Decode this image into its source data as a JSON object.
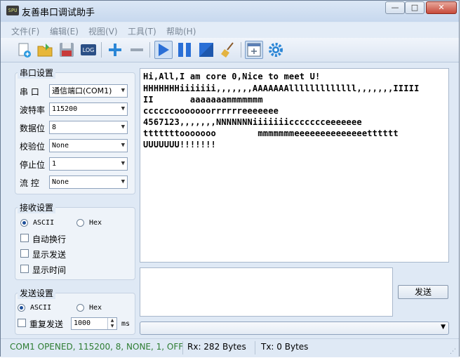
{
  "window": {
    "title": "友善串口调试助手",
    "app_icon_text": "SPU",
    "minimize": "—",
    "maximize": "□",
    "close": "✕"
  },
  "menu": [
    "文件(F)",
    "编辑(E)",
    "视图(V)",
    "工具(T)",
    "帮助(H)"
  ],
  "toolbar": {
    "log_label": "LOG"
  },
  "serial_settings": {
    "title": "串口设置",
    "port_label": "串 口",
    "port_value": "通信端口(COM1)",
    "baud_label": "波特率",
    "baud_value": "115200",
    "databits_label": "数据位",
    "databits_value": "8",
    "parity_label": "校验位",
    "parity_value": "None",
    "stopbits_label": "停止位",
    "stopbits_value": "1",
    "flow_label": "流 控",
    "flow_value": "None"
  },
  "receive_settings": {
    "title": "接收设置",
    "ascii_label": "ASCII",
    "hex_label": "Hex",
    "auto_wrap": "自动换行",
    "show_send": "显示发送",
    "show_time": "显示时间"
  },
  "send_settings": {
    "title": "发送设置",
    "ascii_label": "ASCII",
    "hex_label": "Hex",
    "repeat_label": "重复发送",
    "interval_value": "1000",
    "interval_unit": "ms"
  },
  "receive_text": [
    "Hi,All,I am core 0,Nice to meet U!",
    "HHHHHHHiiiiiii,,,,,,,AAAAAAAlllllllllllll,,,,,,,IIIII",
    "II       aaaaaaammmmmmm",
    "ccccccooooooorrrrrreeeeeee",
    "4567123,,,,,,,NNNNNNNiiiiiiiccccccceeeeeee",
    "tttttttooooooo        mmmmmmmeeeeeeeeeeeeeetttttt",
    "UUUUUUU!!!!!!!"
  ],
  "send_button": "发送",
  "status": {
    "connection": "COM1 OPENED, 115200, 8, NONE, 1, OFF",
    "rx": "Rx: 282 Bytes",
    "tx": "Tx: 0 Bytes"
  },
  "colors": {
    "status_green": "#2e7d32",
    "accent_blue": "#2a6fd6"
  }
}
